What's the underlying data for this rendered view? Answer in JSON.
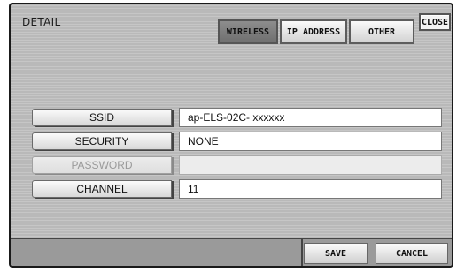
{
  "dialog": {
    "title": "DETAIL",
    "close_label": "CLOSE"
  },
  "tabs": [
    {
      "label": "WIRELESS",
      "active": true
    },
    {
      "label": "IP ADDRESS",
      "active": false
    },
    {
      "label": "OTHER",
      "active": false
    }
  ],
  "fields": [
    {
      "label": "SSID",
      "value": "ap-ELS-02C- xxxxxx",
      "enabled": true
    },
    {
      "label": "SECURITY",
      "value": "NONE",
      "enabled": true
    },
    {
      "label": "PASSWORD",
      "value": "",
      "enabled": false
    },
    {
      "label": "CHANNEL",
      "value": "11",
      "enabled": true
    }
  ],
  "footer": {
    "save_label": "SAVE",
    "cancel_label": "CANCEL"
  }
}
